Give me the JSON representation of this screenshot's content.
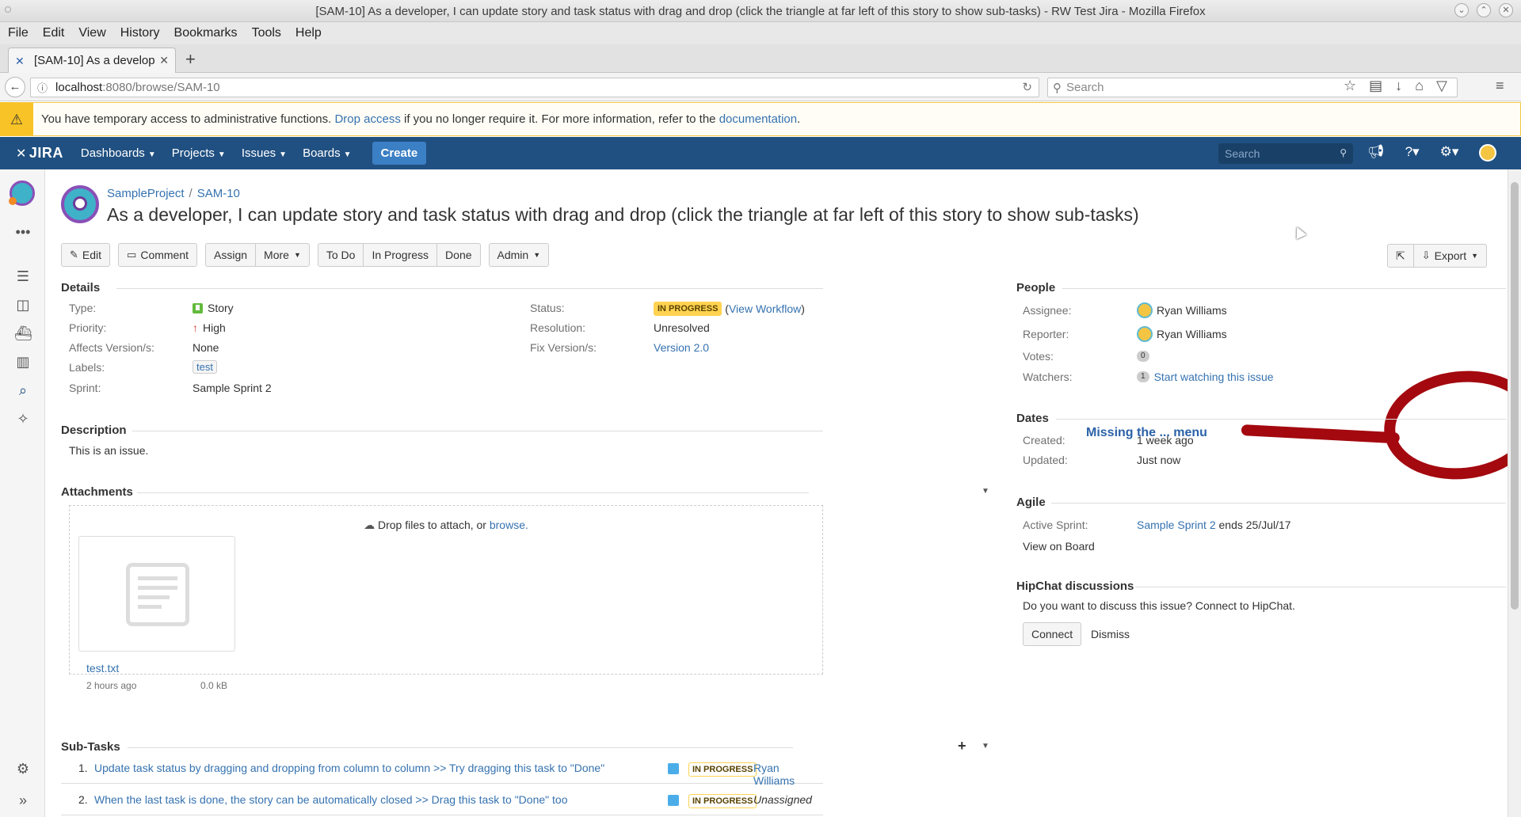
{
  "window": {
    "title": "[SAM-10] As a developer, I can update story and task status with drag and drop (click the triangle at far left of this story to show sub-tasks) - RW Test Jira - Mozilla Firefox"
  },
  "browser": {
    "menu": [
      "File",
      "Edit",
      "View",
      "History",
      "Bookmarks",
      "Tools",
      "Help"
    ],
    "tab_label": "[SAM-10] As a develop",
    "url_host": "localhost",
    "url_path": ":8080/browse/SAM-10",
    "search_placeholder": "Search"
  },
  "admin_banner": {
    "text_before": "You have temporary access to administrative functions. ",
    "drop_link": "Drop access",
    "text_middle": " if you no longer require it. For more information, refer to the ",
    "doc_link": "documentation",
    "text_after": "."
  },
  "jira_header": {
    "logo": "JIRA",
    "nav": [
      "Dashboards",
      "Projects",
      "Issues",
      "Boards"
    ],
    "create_label": "Create",
    "search_placeholder": "Search"
  },
  "issue": {
    "project": "SampleProject",
    "key": "SAM-10",
    "summary": "As a developer, I can update story and task status with drag and drop (click the triangle at far left of this story to show sub-tasks)"
  },
  "toolbar": {
    "edit": "Edit",
    "comment": "Comment",
    "assign": "Assign",
    "more": "More",
    "todo": "To Do",
    "inprogress": "In Progress",
    "done": "Done",
    "admin": "Admin",
    "export": "Export"
  },
  "annotation": "Missing the ... menu",
  "details": {
    "heading": "Details",
    "type_label": "Type:",
    "type_value": "Story",
    "priority_label": "Priority:",
    "priority_value": "High",
    "affects_label": "Affects Version/s:",
    "affects_value": "None",
    "labels_label": "Labels:",
    "labels_value": "test",
    "sprint_label": "Sprint:",
    "sprint_value": "Sample Sprint 2",
    "status_label": "Status:",
    "status_value": "IN PROGRESS",
    "view_workflow": "View Workflow",
    "resolution_label": "Resolution:",
    "resolution_value": "Unresolved",
    "fix_label": "Fix Version/s:",
    "fix_value": "Version 2.0"
  },
  "description": {
    "heading": "Description",
    "text": "This is an issue."
  },
  "attachments": {
    "heading": "Attachments",
    "drop_text": "Drop files to attach, or ",
    "browse": "browse.",
    "file_name": "test.txt",
    "file_age": "2 hours ago",
    "file_size": "0.0 kB"
  },
  "subtasks": {
    "heading": "Sub-Tasks",
    "items": [
      {
        "num": "1.",
        "title": "Update task status by dragging and dropping from column to column >> Try dragging this task to \"Done\"",
        "status": "IN PROGRESS",
        "assignee": "Ryan Williams"
      },
      {
        "num": "2.",
        "title": "When the last task is done, the story can be automatically closed >> Drag this task to \"Done\" too",
        "status": "IN PROGRESS",
        "assignee": "Unassigned"
      }
    ]
  },
  "people": {
    "heading": "People",
    "assignee_label": "Assignee:",
    "assignee": "Ryan Williams",
    "reporter_label": "Reporter:",
    "reporter": "Ryan Williams",
    "votes_label": "Votes:",
    "votes": "0",
    "watchers_label": "Watchers:",
    "watchers": "1",
    "watch_link": "Start watching this issue"
  },
  "dates": {
    "heading": "Dates",
    "created_label": "Created:",
    "created": "1 week ago",
    "updated_label": "Updated:",
    "updated": "Just now"
  },
  "agile": {
    "heading": "Agile",
    "sprint_label": "Active Sprint:",
    "sprint": "Sample Sprint 2",
    "ends": " ends 25/Jul/17",
    "board_link": "View on Board"
  },
  "hipchat": {
    "heading": "HipChat discussions",
    "text": "Do you want to discuss this issue? Connect to HipChat.",
    "connect": "Connect",
    "dismiss": "Dismiss"
  },
  "colors": {
    "header": "#205081",
    "link": "#3572b0",
    "annotation_red": "#a3090f",
    "lozenge": "#ffd351"
  }
}
